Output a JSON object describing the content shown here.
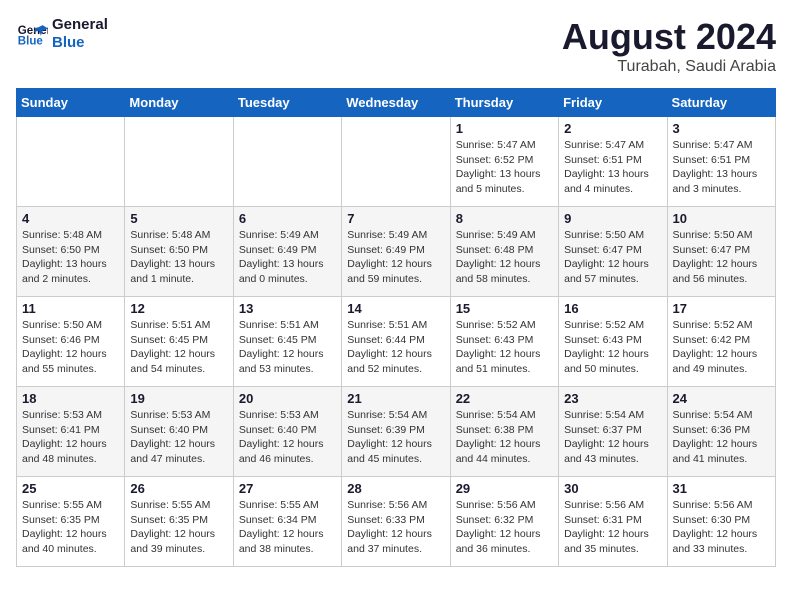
{
  "header": {
    "logo_line1": "General",
    "logo_line2": "Blue",
    "main_title": "August 2024",
    "subtitle": "Turabah, Saudi Arabia"
  },
  "days_of_week": [
    "Sunday",
    "Monday",
    "Tuesday",
    "Wednesday",
    "Thursday",
    "Friday",
    "Saturday"
  ],
  "weeks": [
    [
      {
        "day": "",
        "info": ""
      },
      {
        "day": "",
        "info": ""
      },
      {
        "day": "",
        "info": ""
      },
      {
        "day": "",
        "info": ""
      },
      {
        "day": "1",
        "info": "Sunrise: 5:47 AM\nSunset: 6:52 PM\nDaylight: 13 hours\nand 5 minutes."
      },
      {
        "day": "2",
        "info": "Sunrise: 5:47 AM\nSunset: 6:51 PM\nDaylight: 13 hours\nand 4 minutes."
      },
      {
        "day": "3",
        "info": "Sunrise: 5:47 AM\nSunset: 6:51 PM\nDaylight: 13 hours\nand 3 minutes."
      }
    ],
    [
      {
        "day": "4",
        "info": "Sunrise: 5:48 AM\nSunset: 6:50 PM\nDaylight: 13 hours\nand 2 minutes."
      },
      {
        "day": "5",
        "info": "Sunrise: 5:48 AM\nSunset: 6:50 PM\nDaylight: 13 hours\nand 1 minute."
      },
      {
        "day": "6",
        "info": "Sunrise: 5:49 AM\nSunset: 6:49 PM\nDaylight: 13 hours\nand 0 minutes."
      },
      {
        "day": "7",
        "info": "Sunrise: 5:49 AM\nSunset: 6:49 PM\nDaylight: 12 hours\nand 59 minutes."
      },
      {
        "day": "8",
        "info": "Sunrise: 5:49 AM\nSunset: 6:48 PM\nDaylight: 12 hours\nand 58 minutes."
      },
      {
        "day": "9",
        "info": "Sunrise: 5:50 AM\nSunset: 6:47 PM\nDaylight: 12 hours\nand 57 minutes."
      },
      {
        "day": "10",
        "info": "Sunrise: 5:50 AM\nSunset: 6:47 PM\nDaylight: 12 hours\nand 56 minutes."
      }
    ],
    [
      {
        "day": "11",
        "info": "Sunrise: 5:50 AM\nSunset: 6:46 PM\nDaylight: 12 hours\nand 55 minutes."
      },
      {
        "day": "12",
        "info": "Sunrise: 5:51 AM\nSunset: 6:45 PM\nDaylight: 12 hours\nand 54 minutes."
      },
      {
        "day": "13",
        "info": "Sunrise: 5:51 AM\nSunset: 6:45 PM\nDaylight: 12 hours\nand 53 minutes."
      },
      {
        "day": "14",
        "info": "Sunrise: 5:51 AM\nSunset: 6:44 PM\nDaylight: 12 hours\nand 52 minutes."
      },
      {
        "day": "15",
        "info": "Sunrise: 5:52 AM\nSunset: 6:43 PM\nDaylight: 12 hours\nand 51 minutes."
      },
      {
        "day": "16",
        "info": "Sunrise: 5:52 AM\nSunset: 6:43 PM\nDaylight: 12 hours\nand 50 minutes."
      },
      {
        "day": "17",
        "info": "Sunrise: 5:52 AM\nSunset: 6:42 PM\nDaylight: 12 hours\nand 49 minutes."
      }
    ],
    [
      {
        "day": "18",
        "info": "Sunrise: 5:53 AM\nSunset: 6:41 PM\nDaylight: 12 hours\nand 48 minutes."
      },
      {
        "day": "19",
        "info": "Sunrise: 5:53 AM\nSunset: 6:40 PM\nDaylight: 12 hours\nand 47 minutes."
      },
      {
        "day": "20",
        "info": "Sunrise: 5:53 AM\nSunset: 6:40 PM\nDaylight: 12 hours\nand 46 minutes."
      },
      {
        "day": "21",
        "info": "Sunrise: 5:54 AM\nSunset: 6:39 PM\nDaylight: 12 hours\nand 45 minutes."
      },
      {
        "day": "22",
        "info": "Sunrise: 5:54 AM\nSunset: 6:38 PM\nDaylight: 12 hours\nand 44 minutes."
      },
      {
        "day": "23",
        "info": "Sunrise: 5:54 AM\nSunset: 6:37 PM\nDaylight: 12 hours\nand 43 minutes."
      },
      {
        "day": "24",
        "info": "Sunrise: 5:54 AM\nSunset: 6:36 PM\nDaylight: 12 hours\nand 41 minutes."
      }
    ],
    [
      {
        "day": "25",
        "info": "Sunrise: 5:55 AM\nSunset: 6:35 PM\nDaylight: 12 hours\nand 40 minutes."
      },
      {
        "day": "26",
        "info": "Sunrise: 5:55 AM\nSunset: 6:35 PM\nDaylight: 12 hours\nand 39 minutes."
      },
      {
        "day": "27",
        "info": "Sunrise: 5:55 AM\nSunset: 6:34 PM\nDaylight: 12 hours\nand 38 minutes."
      },
      {
        "day": "28",
        "info": "Sunrise: 5:56 AM\nSunset: 6:33 PM\nDaylight: 12 hours\nand 37 minutes."
      },
      {
        "day": "29",
        "info": "Sunrise: 5:56 AM\nSunset: 6:32 PM\nDaylight: 12 hours\nand 36 minutes."
      },
      {
        "day": "30",
        "info": "Sunrise: 5:56 AM\nSunset: 6:31 PM\nDaylight: 12 hours\nand 35 minutes."
      },
      {
        "day": "31",
        "info": "Sunrise: 5:56 AM\nSunset: 6:30 PM\nDaylight: 12 hours\nand 33 minutes."
      }
    ]
  ]
}
